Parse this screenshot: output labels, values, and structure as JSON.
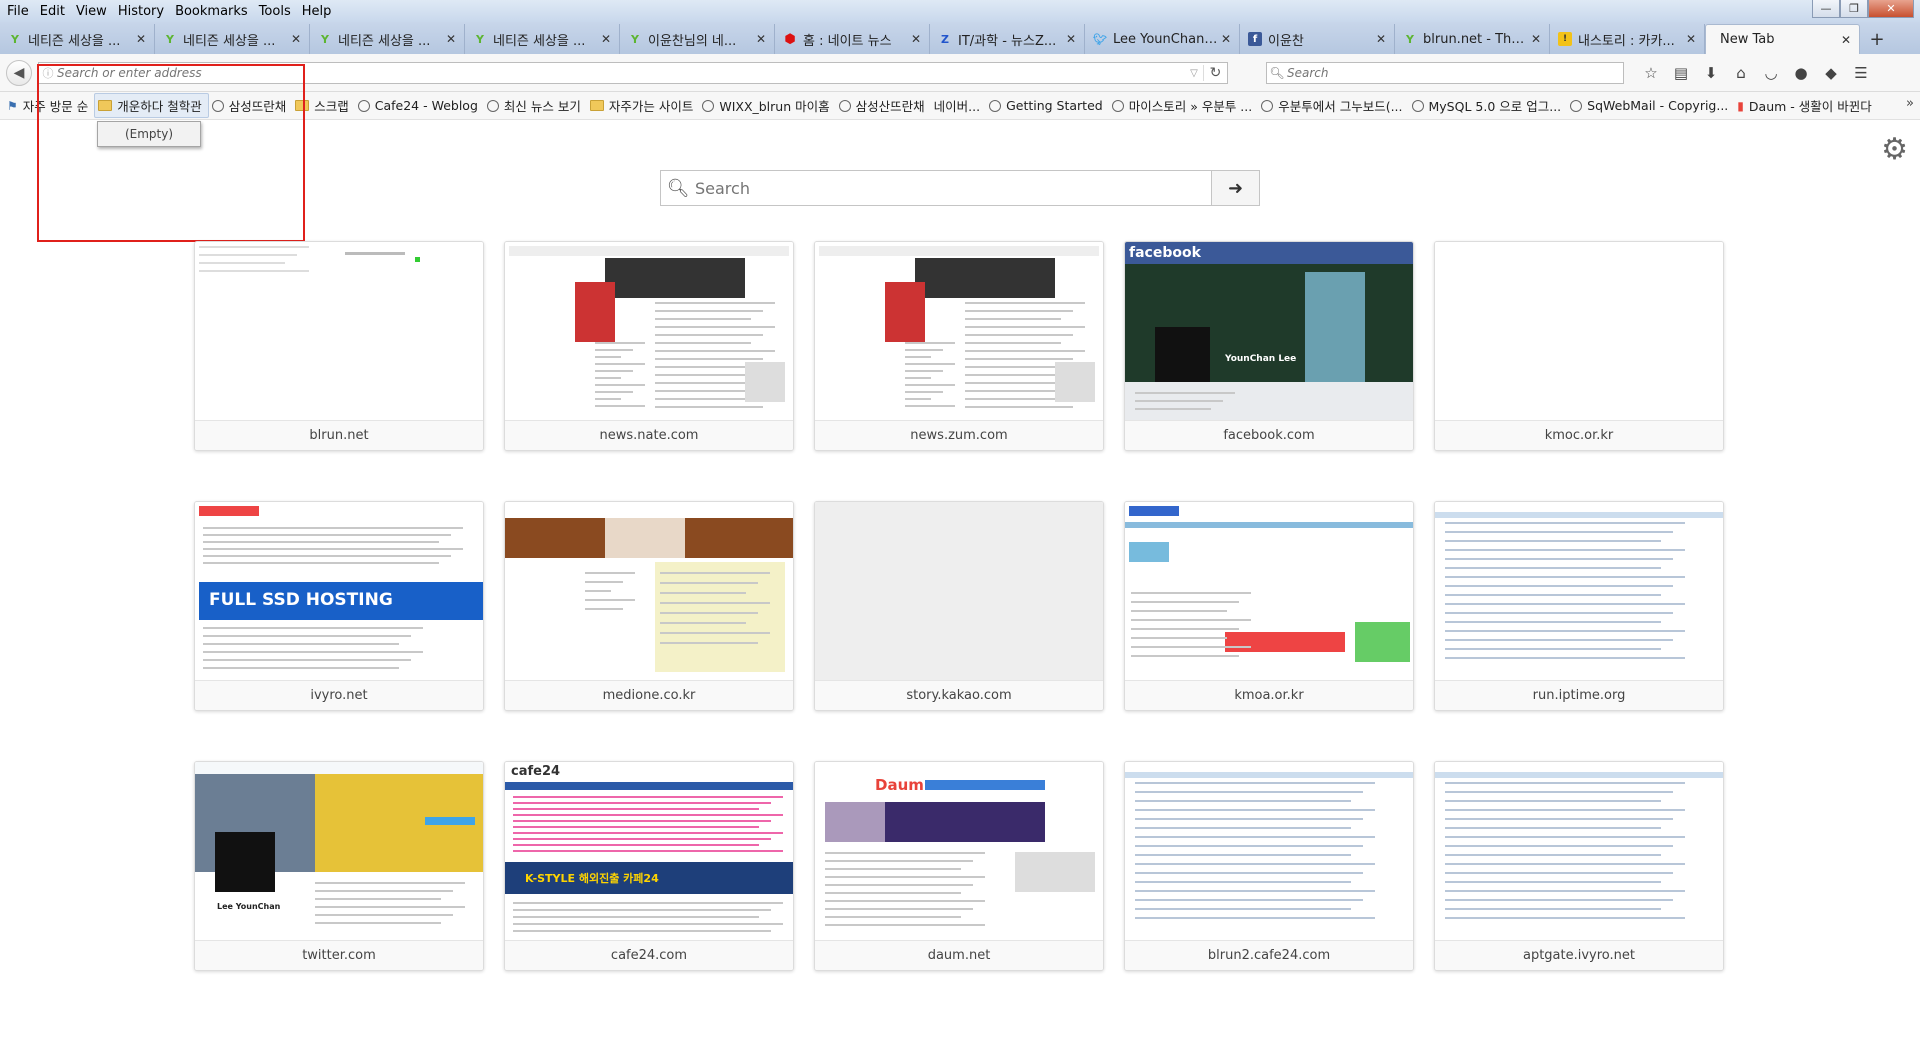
{
  "menu": [
    "File",
    "Edit",
    "View",
    "History",
    "Bookmarks",
    "Tools",
    "Help"
  ],
  "window_controls": {
    "minimize": "—",
    "maximize": "❐",
    "close": "✕"
  },
  "tabs": [
    {
      "title": "네티즌 세상을 ...",
      "icon": "nate-icon",
      "active": false
    },
    {
      "title": "네티즌 세상을 ...",
      "icon": "nate-icon",
      "active": false
    },
    {
      "title": "네티즌 세상을 ...",
      "icon": "nate-icon",
      "active": false
    },
    {
      "title": "네티즌 세상을 ...",
      "icon": "nate-icon",
      "active": false
    },
    {
      "title": "이윤찬님의 네...",
      "icon": "nate-icon",
      "active": false
    },
    {
      "title": "홈 : 네이트 뉴스",
      "icon": "red-icon",
      "active": false
    },
    {
      "title": "IT/과학 - 뉴스Z...",
      "icon": "zum-icon",
      "active": false
    },
    {
      "title": "Lee YounChan(...",
      "icon": "twitter-icon",
      "active": false
    },
    {
      "title": "이윤찬",
      "icon": "facebook-icon",
      "active": false
    },
    {
      "title": "blrun.net - Thro...",
      "icon": "nate-icon",
      "active": false
    },
    {
      "title": "내스토리 : 카카...",
      "icon": "note-icon",
      "active": false
    },
    {
      "title": "New Tab",
      "icon": "",
      "active": true
    }
  ],
  "newtab_button": "+",
  "navbar": {
    "url_placeholder": "Search or enter address",
    "search_placeholder": "Search"
  },
  "bookmarks": [
    {
      "label": "자주 방문 순",
      "icon": "bookmark-list-icon"
    },
    {
      "label": "개운하다 철학관",
      "icon": "folder-icon",
      "hover": true
    },
    {
      "label": "삼성뜨란채",
      "icon": "globe-icon"
    },
    {
      "label": "스크랩",
      "icon": "folder-icon"
    },
    {
      "label": "Cafe24 - Weblog",
      "icon": "globe-icon"
    },
    {
      "label": "최신 뉴스 보기",
      "icon": "globe-icon"
    },
    {
      "label": "자주가는 사이트",
      "icon": "folder-icon"
    },
    {
      "label": "WIXX_blrun 마이홈",
      "icon": "globe-icon"
    },
    {
      "label": "삼성산뜨란채",
      "icon": "globe-icon"
    },
    {
      "label": "네이버...",
      "icon": ""
    },
    {
      "label": "Getting Started",
      "icon": "globe-icon"
    },
    {
      "label": "마이스토리 » 우분투 ...",
      "icon": "globe-icon"
    },
    {
      "label": "우분투에서 그누보드(...",
      "icon": "globe-icon"
    },
    {
      "label": "MySQL 5.0 으로 업그...",
      "icon": "globe-icon"
    },
    {
      "label": "SqWebMail - Copyrig...",
      "icon": "globe-icon"
    },
    {
      "label": "Daum - 생활이 바뀐다",
      "icon": "daum-icon"
    }
  ],
  "bookmark_popup": "(Empty)",
  "newtab_search": {
    "placeholder": "Search"
  },
  "tiles": [
    {
      "label": "blrun.net",
      "style": "blank-lines"
    },
    {
      "label": "news.nate.com",
      "style": "news"
    },
    {
      "label": "news.zum.com",
      "style": "news"
    },
    {
      "label": "facebook.com",
      "style": "facebook"
    },
    {
      "label": "kmoc.or.kr",
      "style": "empty"
    },
    {
      "label": "ivyro.net",
      "style": "hosting"
    },
    {
      "label": "medione.co.kr",
      "style": "brown"
    },
    {
      "label": "story.kakao.com",
      "style": "grey"
    },
    {
      "label": "kmoa.or.kr",
      "style": "portal"
    },
    {
      "label": "run.iptime.org",
      "style": "list"
    },
    {
      "label": "twitter.com",
      "style": "twitter"
    },
    {
      "label": "cafe24.com",
      "style": "cafe24"
    },
    {
      "label": "daum.net",
      "style": "daum"
    },
    {
      "label": "blrun2.cafe24.com",
      "style": "list"
    },
    {
      "label": "aptgate.ivyro.net",
      "style": "list"
    }
  ],
  "thumb_text": {
    "facebook": "facebook",
    "hosting": "FULL SSD HOSTING",
    "cafe24_logo": "cafe24",
    "cafe24_banner": "K-STYLE 해외진출 카페24",
    "daum_logo": "Daum",
    "twitter_name": "Lee YounChan",
    "facebook_name": "YounChan Lee"
  },
  "colors": {
    "accent": "#3b5998",
    "highlight": "#e0201b"
  }
}
